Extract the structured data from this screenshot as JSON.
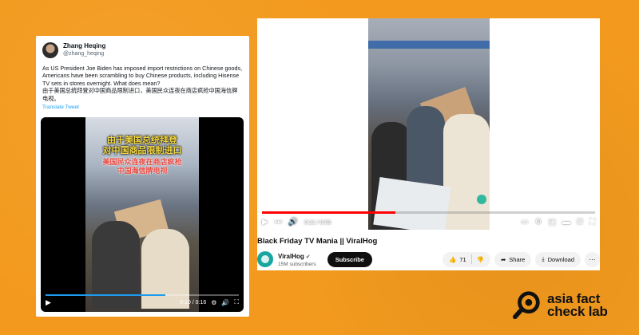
{
  "tweet": {
    "name": "Zhang Heqing",
    "handle": "@zhang_heqing",
    "text_en": "As US President Joe Biden has imposed import restrictions on Chinese goods, Americans have been scrambling to buy Chinese products, including Hisense TV sets in stores overnight. What does mean?",
    "text_cn": "由于美国总统拜登对中国商品限制进口，美国民众连夜在商店疯抢中国海信牌电视。",
    "translate_label": "Translate Tweet",
    "video": {
      "caption_line1": "由于美国总统拜登",
      "caption_line2": "对中国商品限制进口",
      "caption_line3": "美国民众连夜在商店疯抢",
      "caption_line4": "中国海信牌电视",
      "time": "0:10 / 0:16",
      "progress": 0.62
    }
  },
  "youtube": {
    "time": "0:21 / 0:53",
    "progress": 0.4,
    "title": "Black Friday TV Mania || ViralHog",
    "channel_name": "ViralHog",
    "subscribers": "15M subscribers",
    "subscribe_label": "Subscribe",
    "like_count": "71",
    "share_label": "Share",
    "download_label": "Download"
  },
  "logo": {
    "line1": "asia fact",
    "line2": "check lab"
  },
  "colors": {
    "background": "#f39a1e",
    "youtube_red": "#ff0000",
    "twitter_blue": "#1d9bf0"
  }
}
